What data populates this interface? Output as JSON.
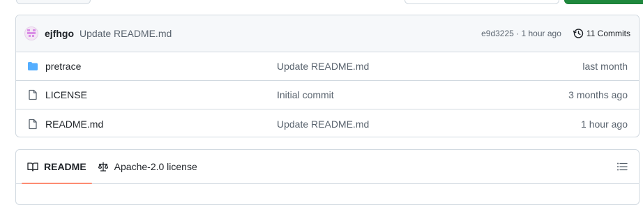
{
  "latest_commit": {
    "author": "ejfhgo",
    "message": "Update README.md",
    "meta": "e9d3225 · 1 hour ago",
    "commits_label": "11 Commits"
  },
  "files": [
    {
      "type": "folder",
      "name": "pretrace",
      "message": "Update README.md",
      "age": "last month"
    },
    {
      "type": "file",
      "name": "LICENSE",
      "message": "Initial commit",
      "age": "3 months ago"
    },
    {
      "type": "file",
      "name": "README.md",
      "message": "Update README.md",
      "age": "1 hour ago"
    }
  ],
  "readme_tabs": {
    "readme": "README",
    "license": "Apache-2.0 license"
  },
  "colors": {
    "folder": "#54aeff",
    "active_tab_underline": "#fd8c73",
    "border": "#d1d9e0"
  }
}
